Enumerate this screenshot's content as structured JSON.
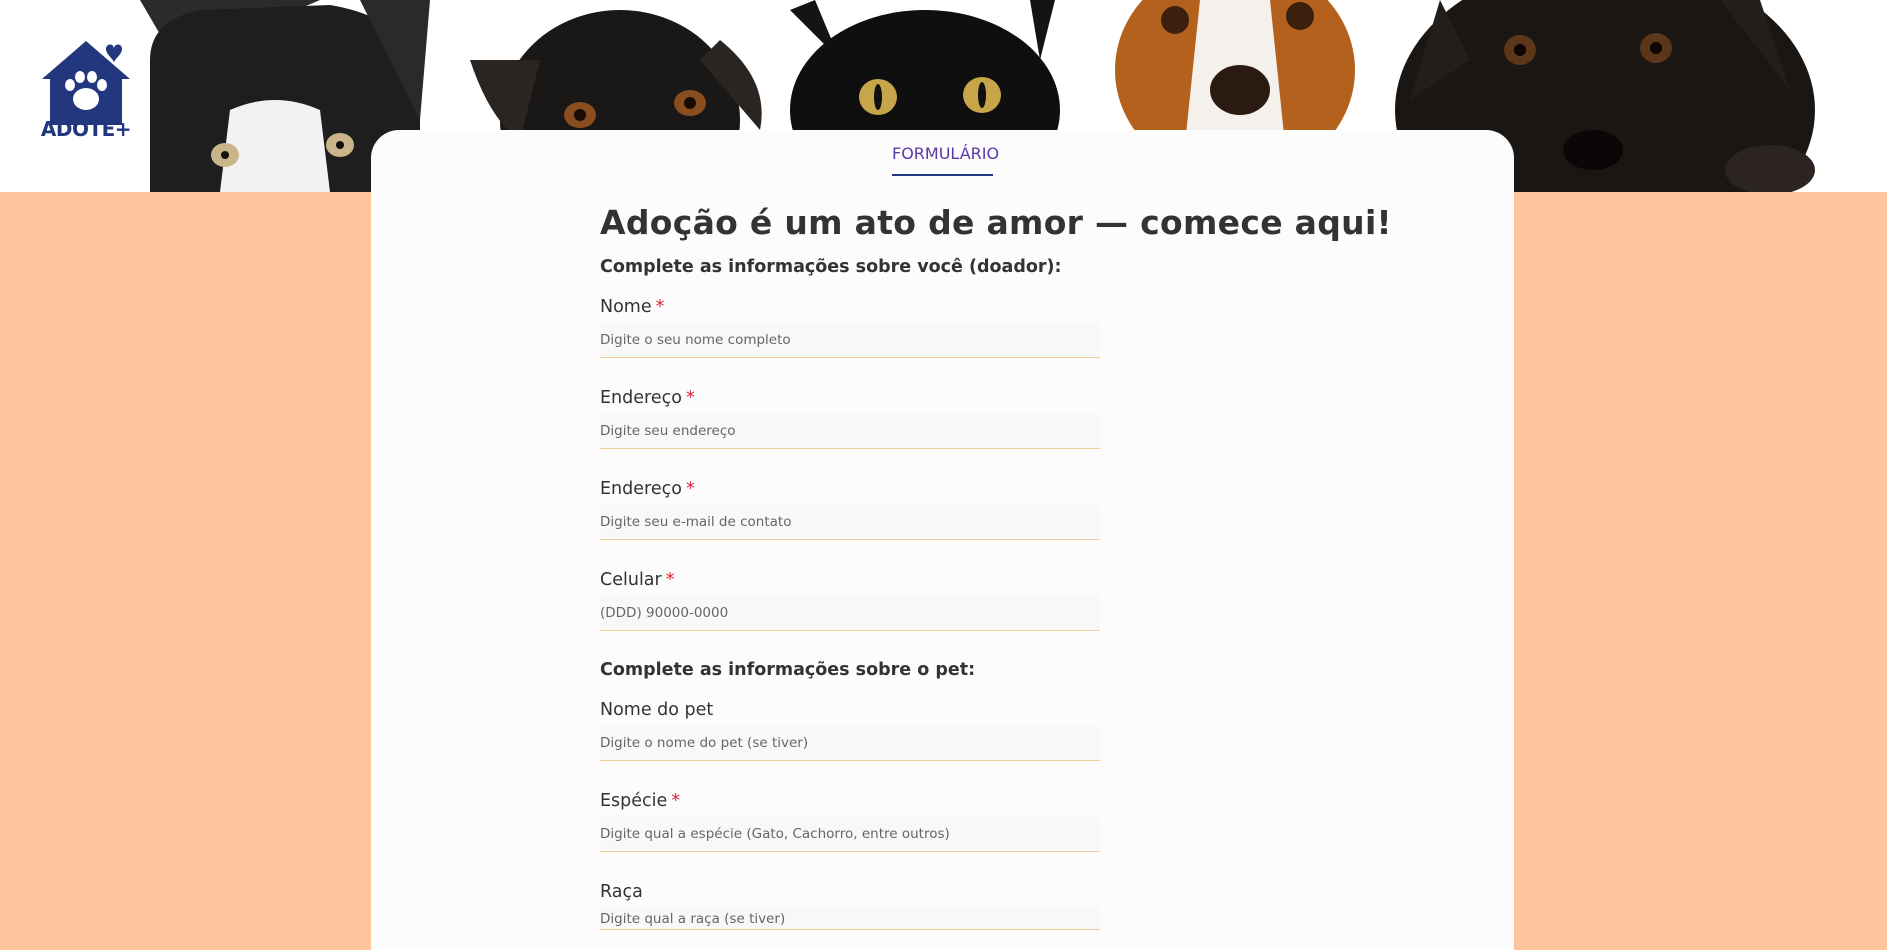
{
  "brand": {
    "name": "ADOTE+"
  },
  "nav": {
    "tab_label": "FORMULÁRIO"
  },
  "page": {
    "title": "Adoção é um ato de amor — comece aqui!"
  },
  "donor": {
    "heading": "Complete as informações sobre você (doador):",
    "fields": [
      {
        "label": "Nome",
        "required": "*",
        "placeholder": "Digite o seu nome completo"
      },
      {
        "label": "Endereço",
        "required": "*",
        "placeholder": "Digite seu endereço"
      },
      {
        "label": "Endereço",
        "required": "*",
        "placeholder": "Digite seu e-mail de contato"
      },
      {
        "label": "Celular",
        "required": "*",
        "placeholder": "(DDD) 90000-0000"
      }
    ]
  },
  "pet": {
    "heading": "Complete as informações sobre o pet:",
    "fields": [
      {
        "label": "Nome do pet",
        "placeholder": "Digite o nome do pet (se tiver)"
      },
      {
        "label": "Espécie",
        "required": "*",
        "placeholder": "Digite qual a espécie (Gato, Cachorro, entre outros)"
      },
      {
        "label": "Raça",
        "placeholder": "Digite qual a raça (se tiver)"
      }
    ]
  },
  "colors": {
    "background": "#fec59c",
    "brand": "#23377f",
    "tab": "#5b3aa4",
    "required": "#d9233a",
    "input_underline": "#f3cf9a"
  },
  "icons": [
    "house-paw-heart-logo-icon"
  ]
}
